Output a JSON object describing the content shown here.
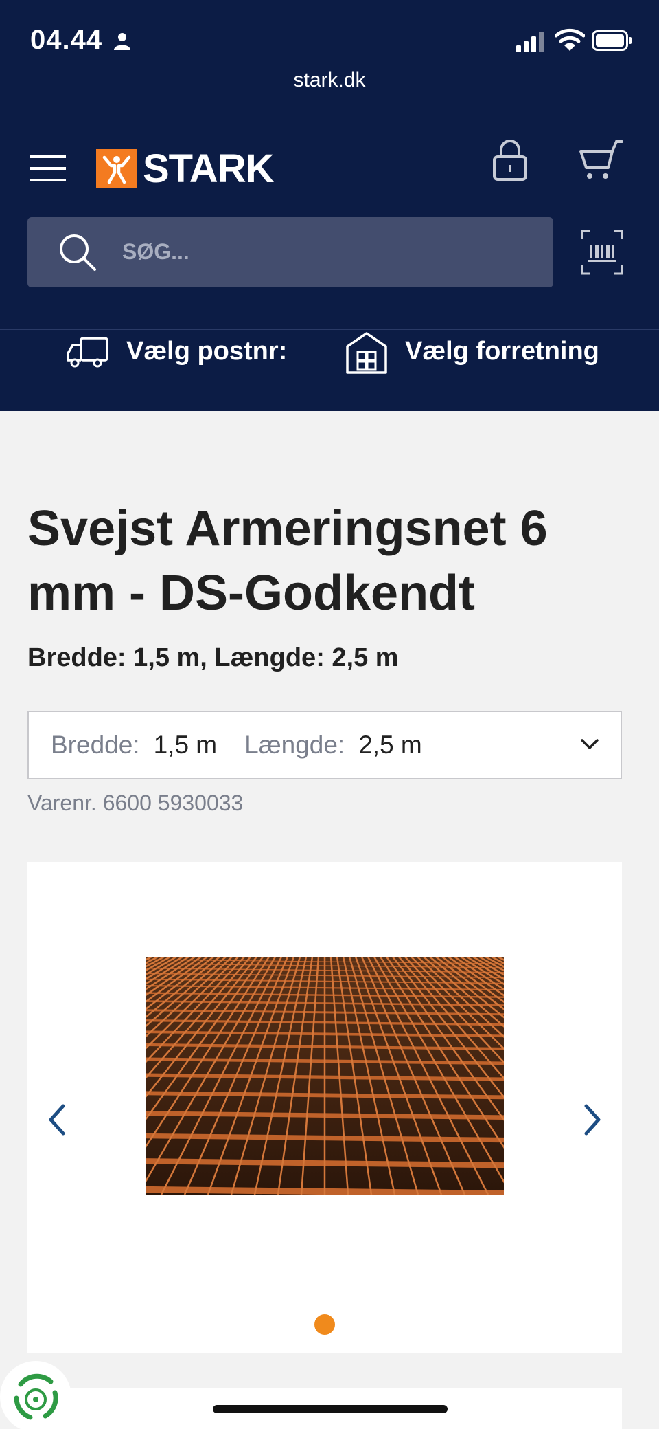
{
  "status": {
    "time": "04.44",
    "url": "stark.dk"
  },
  "header": {
    "brand": "STARK"
  },
  "search": {
    "placeholder": "SØG..."
  },
  "delivery": {
    "postnr_label": "Vælg postnr:",
    "store_label": "Vælg forretning"
  },
  "product": {
    "title": "Svejst Armeringsnet 6 mm - DS-Godkendt",
    "subtitle": "Bredde: 1,5 m, Længde: 2,5 m",
    "variant": {
      "width_label": "Bredde:",
      "width_value": "1,5 m",
      "length_label": "Længde:",
      "length_value": "2,5 m"
    },
    "sku": "Varenr. 6600 5930033"
  },
  "gallery": {
    "image_count": 1,
    "active_index": 0
  },
  "colors": {
    "navy": "#0c1c45",
    "orange": "#f47b20",
    "dot": "#f08a1c"
  }
}
